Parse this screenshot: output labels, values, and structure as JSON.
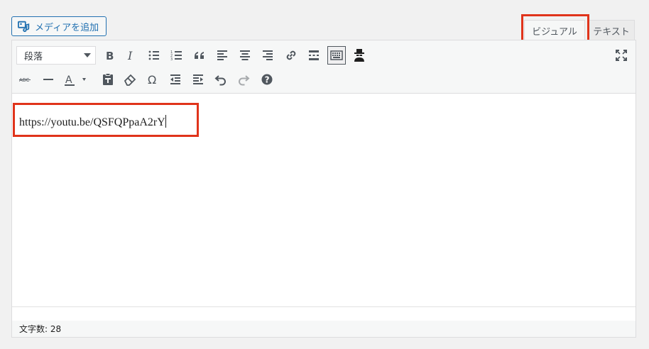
{
  "media_button": {
    "label": "メディアを追加",
    "icon": "media-add-icon"
  },
  "tabs": [
    {
      "label": "ビジュアル",
      "active": true
    },
    {
      "label": "テキスト",
      "active": false
    }
  ],
  "toolbar": {
    "format_select": {
      "value": "段落"
    },
    "row1": [
      {
        "name": "bold-icon"
      },
      {
        "name": "italic-icon"
      },
      {
        "name": "bullet-list-icon"
      },
      {
        "name": "numbered-list-icon"
      },
      {
        "name": "blockquote-icon"
      },
      {
        "name": "align-left-icon"
      },
      {
        "name": "align-center-icon"
      },
      {
        "name": "align-right-icon"
      },
      {
        "name": "link-icon"
      },
      {
        "name": "read-more-icon"
      },
      {
        "name": "toolbar-toggle-icon"
      },
      {
        "name": "spy-icon"
      }
    ],
    "row2": [
      {
        "name": "strikethrough-icon",
        "text": "ABC"
      },
      {
        "name": "horizontal-line-icon"
      },
      {
        "name": "text-color-icon",
        "text": "A"
      },
      {
        "name": "paste-text-icon"
      },
      {
        "name": "clear-formatting-icon"
      },
      {
        "name": "special-character-icon",
        "text": "Ω"
      },
      {
        "name": "outdent-icon"
      },
      {
        "name": "indent-icon"
      },
      {
        "name": "undo-icon"
      },
      {
        "name": "redo-icon"
      },
      {
        "name": "help-icon",
        "text": "?"
      }
    ],
    "fullscreen_icon": "fullscreen-icon"
  },
  "content": {
    "text": "https://youtu.be/QSFQPpaA2rY"
  },
  "status": {
    "word_count_label": "文字数: 28"
  },
  "colors": {
    "accent": "#2271b1",
    "highlight": "#e0341b"
  }
}
